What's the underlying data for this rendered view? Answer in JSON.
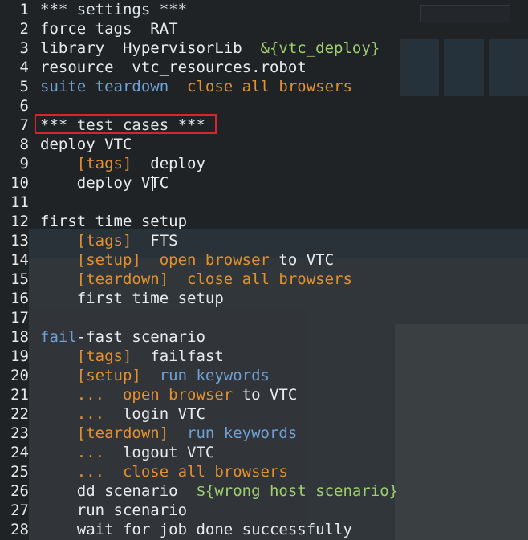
{
  "editor": {
    "lines": [
      {
        "n": "1",
        "parts": [
          {
            "t": "*** settings ***",
            "c": "head"
          }
        ]
      },
      {
        "n": "2",
        "parts": [
          {
            "t": "force tags  RAT",
            "c": "white"
          }
        ]
      },
      {
        "n": "3",
        "parts": [
          {
            "t": "library  HypervisorLib  ",
            "c": "white"
          },
          {
            "t": "&{vtc_deploy}",
            "c": "var"
          }
        ]
      },
      {
        "n": "4",
        "parts": [
          {
            "t": "resource  vtc_resources.robot",
            "c": "white"
          }
        ]
      },
      {
        "n": "5",
        "parts": [
          {
            "t": "suite teardown  ",
            "c": "kw"
          },
          {
            "t": "close all browsers",
            "c": "setting"
          }
        ]
      },
      {
        "n": "6",
        "parts": []
      },
      {
        "n": "7",
        "parts": [
          {
            "t": "*** test cases ***",
            "c": "head"
          }
        ]
      },
      {
        "n": "8",
        "parts": [
          {
            "t": "deploy VTC",
            "c": "white"
          }
        ]
      },
      {
        "n": "9",
        "parts": [
          {
            "t": "    ",
            "c": "white"
          },
          {
            "t": "[tags]",
            "c": "setting"
          },
          {
            "t": "  deploy",
            "c": "white"
          }
        ]
      },
      {
        "n": "10",
        "parts": [
          {
            "t": "    deploy VTC",
            "c": "white"
          }
        ]
      },
      {
        "n": "11",
        "parts": []
      },
      {
        "n": "12",
        "parts": [
          {
            "t": "first time setup",
            "c": "white"
          }
        ]
      },
      {
        "n": "13",
        "parts": [
          {
            "t": "    ",
            "c": "white"
          },
          {
            "t": "[tags]",
            "c": "setting"
          },
          {
            "t": "  FTS",
            "c": "white"
          }
        ]
      },
      {
        "n": "14",
        "parts": [
          {
            "t": "    ",
            "c": "white"
          },
          {
            "t": "[setup]  open browser",
            "c": "setting"
          },
          {
            "t": " to VTC",
            "c": "white"
          }
        ]
      },
      {
        "n": "15",
        "parts": [
          {
            "t": "    ",
            "c": "white"
          },
          {
            "t": "[teardown]  close all browsers",
            "c": "setting"
          }
        ]
      },
      {
        "n": "16",
        "parts": [
          {
            "t": "    first time setup",
            "c": "white"
          }
        ]
      },
      {
        "n": "17",
        "parts": []
      },
      {
        "n": "18",
        "parts": [
          {
            "t": "fail",
            "c": "kw"
          },
          {
            "t": "-fast scenario",
            "c": "white"
          }
        ]
      },
      {
        "n": "19",
        "parts": [
          {
            "t": "    ",
            "c": "white"
          },
          {
            "t": "[tags]",
            "c": "setting"
          },
          {
            "t": "  failfast",
            "c": "white"
          }
        ]
      },
      {
        "n": "20",
        "parts": [
          {
            "t": "    ",
            "c": "white"
          },
          {
            "t": "[setup]",
            "c": "setting"
          },
          {
            "t": "  run keywords",
            "c": "kw"
          }
        ]
      },
      {
        "n": "21",
        "parts": [
          {
            "t": "    ",
            "c": "white"
          },
          {
            "t": "...  open browser",
            "c": "setting"
          },
          {
            "t": " to VTC",
            "c": "white"
          }
        ]
      },
      {
        "n": "22",
        "parts": [
          {
            "t": "    ",
            "c": "white"
          },
          {
            "t": "...",
            "c": "setting"
          },
          {
            "t": "  login VTC",
            "c": "white"
          }
        ]
      },
      {
        "n": "23",
        "parts": [
          {
            "t": "    ",
            "c": "white"
          },
          {
            "t": "[teardown]",
            "c": "setting"
          },
          {
            "t": "  run keywords",
            "c": "kw"
          }
        ]
      },
      {
        "n": "24",
        "parts": [
          {
            "t": "    ",
            "c": "white"
          },
          {
            "t": "...",
            "c": "setting"
          },
          {
            "t": "  logout VTC",
            "c": "white"
          }
        ]
      },
      {
        "n": "25",
        "parts": [
          {
            "t": "    ",
            "c": "white"
          },
          {
            "t": "...  close all browsers",
            "c": "setting"
          }
        ]
      },
      {
        "n": "26",
        "parts": [
          {
            "t": "    dd scenario  ",
            "c": "white"
          },
          {
            "t": "${wrong host scenario}",
            "c": "var"
          }
        ]
      },
      {
        "n": "27",
        "parts": [
          {
            "t": "    run scenario",
            "c": "white"
          }
        ]
      },
      {
        "n": "28",
        "parts": [
          {
            "t": "    wait for job done successfully",
            "c": "white"
          }
        ]
      }
    ]
  },
  "highlight": {
    "line": "7",
    "color": "#d6262b"
  },
  "colors": {
    "background": "#1f2326",
    "keyword_blue": "#6fa0d6",
    "setting_orange": "#e3902f",
    "variable_green": "#9fd070"
  }
}
